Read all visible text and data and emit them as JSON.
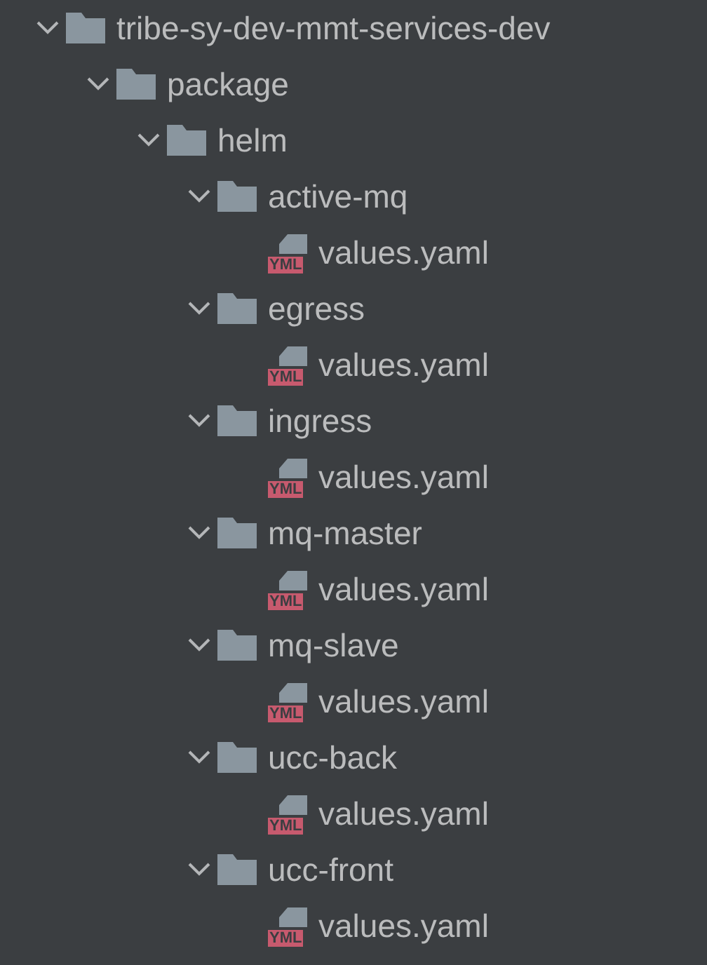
{
  "tree": [
    {
      "kind": "folder",
      "label": "tribe-sy-dev-mmt-services-dev",
      "expanded": true,
      "children": [
        {
          "kind": "folder",
          "label": "package",
          "expanded": true,
          "children": [
            {
              "kind": "folder",
              "label": "helm",
              "expanded": true,
              "children": [
                {
                  "kind": "folder",
                  "label": "active-mq",
                  "expanded": true,
                  "children": [
                    {
                      "kind": "file",
                      "label": "values.yaml",
                      "badge": "YML"
                    }
                  ]
                },
                {
                  "kind": "folder",
                  "label": "egress",
                  "expanded": true,
                  "children": [
                    {
                      "kind": "file",
                      "label": "values.yaml",
                      "badge": "YML"
                    }
                  ]
                },
                {
                  "kind": "folder",
                  "label": "ingress",
                  "expanded": true,
                  "children": [
                    {
                      "kind": "file",
                      "label": "values.yaml",
                      "badge": "YML"
                    }
                  ]
                },
                {
                  "kind": "folder",
                  "label": "mq-master",
                  "expanded": true,
                  "children": [
                    {
                      "kind": "file",
                      "label": "values.yaml",
                      "badge": "YML"
                    }
                  ]
                },
                {
                  "kind": "folder",
                  "label": "mq-slave",
                  "expanded": true,
                  "children": [
                    {
                      "kind": "file",
                      "label": "values.yaml",
                      "badge": "YML"
                    }
                  ]
                },
                {
                  "kind": "folder",
                  "label": "ucc-back",
                  "expanded": true,
                  "children": [
                    {
                      "kind": "file",
                      "label": "values.yaml",
                      "badge": "YML"
                    }
                  ]
                },
                {
                  "kind": "folder",
                  "label": "ucc-front",
                  "expanded": true,
                  "children": [
                    {
                      "kind": "file",
                      "label": "values.yaml",
                      "badge": "YML"
                    }
                  ]
                }
              ]
            }
          ]
        }
      ]
    }
  ]
}
